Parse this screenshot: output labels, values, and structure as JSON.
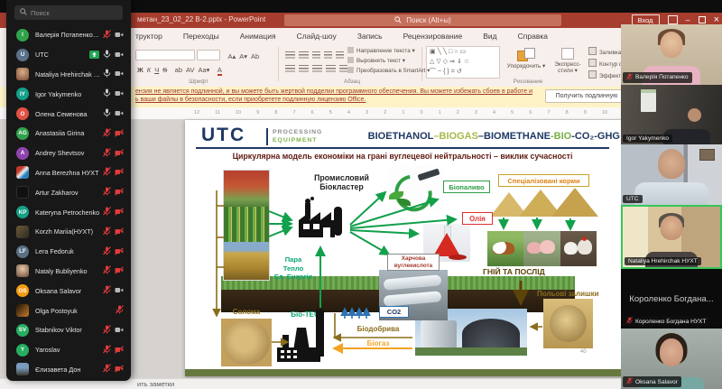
{
  "zoom_panel": {
    "search_placeholder": "Поиск",
    "participants": [
      {
        "name": "Валерія Потапенко (Организатор, я)",
        "type": "initials",
        "initials": "I",
        "color": "#31a24c",
        "mic": "muted",
        "cam": "on"
      },
      {
        "name": "UTC",
        "type": "initials",
        "initials": "U",
        "color": "#5b718a",
        "mic": "on",
        "cam": "on",
        "badge": true
      },
      {
        "name": "Nataliya Hrehirchak НУХТ",
        "type": "photo",
        "photo": "ph-warm",
        "mic": "on",
        "cam": "on"
      },
      {
        "name": "Igor Yakymenko",
        "type": "initials",
        "initials": "IY",
        "color": "#13a089",
        "mic": "on",
        "cam": "on"
      },
      {
        "name": "Олена Семенова",
        "type": "initials",
        "initials": "O",
        "color": "#e25041",
        "mic": "on",
        "cam": "on"
      },
      {
        "name": "Anastasiia Girina",
        "type": "initials",
        "initials": "AG",
        "color": "#31a24c",
        "mic": "muted",
        "cam": "off"
      },
      {
        "name": "Andrey Shevtsov",
        "type": "initials",
        "initials": "A",
        "color": "#8e44ad",
        "mic": "muted",
        "cam": "off"
      },
      {
        "name": "Anna Berezhna НУХТ",
        "type": "photo",
        "photo": "ph-mixed",
        "mic": "muted",
        "cam": "off"
      },
      {
        "name": "Artur Zakharov",
        "type": "photo",
        "photo": "ph-dark",
        "mic": "muted",
        "cam": "off"
      },
      {
        "name": "Kateryna Petrochenko",
        "type": "initials",
        "initials": "KP",
        "color": "#16a085",
        "mic": "muted",
        "cam": "off"
      },
      {
        "name": "Korzh Mariia(НУХТ)",
        "type": "photo",
        "photo": "ph-olive",
        "mic": "muted",
        "cam": "off"
      },
      {
        "name": "Lera Fedoruk",
        "type": "initials",
        "initials": "LF",
        "color": "#5a7184",
        "mic": "muted",
        "cam": "off"
      },
      {
        "name": "Nataly Bubliyenko",
        "type": "photo",
        "photo": "ph-portrait",
        "mic": "muted",
        "cam": "off"
      },
      {
        "name": "Oksana Salavor",
        "type": "initials",
        "initials": "OS",
        "color": "#f39c12",
        "mic": "muted",
        "cam": "on"
      },
      {
        "name": "Olga Postoyuk",
        "type": "photo",
        "photo": "ph-fire",
        "mic": "muted",
        "cam": "none"
      },
      {
        "name": "Stabnikov Viktor",
        "type": "initials",
        "initials": "SV",
        "color": "#27ae60",
        "mic": "muted",
        "cam": "on"
      },
      {
        "name": "Yaroslav",
        "type": "initials",
        "initials": "Y",
        "color": "#27ae60",
        "mic": "muted",
        "cam": "off"
      },
      {
        "name": "Єлизавета Дон",
        "type": "photo",
        "photo": "ph-landscape",
        "mic": "muted",
        "cam": "off"
      }
    ]
  },
  "powerpoint": {
    "titlebar": {
      "document_title": "метан_23_02_22 В-2.pptx  -  PowerPoint",
      "search_placeholder": "Поиск (Alt+ы)",
      "sign_in_label": "Вход"
    },
    "tabs": [
      "труктор",
      "Переходы",
      "Анимация",
      "Слайд-шоу",
      "Запись",
      "Рецензирование",
      "Вид",
      "Справка"
    ],
    "ribbon": {
      "group_font": "Шрифт",
      "group_paragraph": "Абзац",
      "group_drawing": "Рисование",
      "paragraph_buttons": [
        "Направление текста",
        "Выровнять текст",
        "Преобразовать в SmartArt"
      ],
      "arrange_label": "Упорядочить",
      "styles_label_1": "Экспресс-",
      "styles_label_2": "стили",
      "fill_label": "Заливка ф",
      "outline_label": "Контур фи",
      "effects_label": "Эффекты ф"
    },
    "license_bar": {
      "line1": "ензия не является подлинной, и вы можете быть жертвой подделки программного обеспечения. Вы можете избежать сбоев в работе и",
      "line2": "ь ваши файлы в безопасности, если приобретете подлинную лицензию Office.",
      "button_label": "Получить подлинную"
    },
    "ruler_numbers": [
      "12",
      "11",
      "10",
      "9",
      "8",
      "7",
      "6",
      "5",
      "4",
      "3",
      "2",
      "1",
      "0",
      "1",
      "2",
      "3",
      "4",
      "5",
      "6",
      "7",
      "8",
      "9",
      "10"
    ],
    "status_notes": "ить заметки"
  },
  "slide": {
    "logo_text": "UTC",
    "logo_processing": "PROCESSING",
    "logo_equipment": "EQUIPMENT",
    "header_title_parts": [
      {
        "text": "BIOETHANOL",
        "color": "#1f3864"
      },
      {
        "text": "–BIOGAS",
        "color": "#a9b949"
      },
      {
        "text": "–BIOMETHANE",
        "color": "#1f3864"
      },
      {
        "text": "-BIO",
        "color": "#76b043"
      },
      {
        "text": "-CO₂-GHG",
        "color": "#1f3864"
      }
    ],
    "subtitle": "Циркулярна модель економіки на грані вуглецевої нейтральності – виклик сучасності",
    "labels": {
      "cluster": "Промисловий\nБіокластер",
      "steam": "Пара\nТепло\nЕл. Енергія",
      "biofuel": "Біопаливо",
      "feed": "Спеціалізовані корми",
      "oil": "Олія",
      "food_co2": "Харчова\nвуглекислота",
      "co2": "CO2",
      "manure": "ГНІЙ ТА ПОСЛІД",
      "field_residues": "Польові залишки",
      "straw": "Солома",
      "bio_tes": "Біо-ТЕС",
      "biofertilizer": "Біодобрива",
      "biogas": "Біогаз",
      "page_number": "40"
    }
  },
  "video_strip": {
    "tiles": [
      {
        "label": "Валерія Потапенко",
        "muted": true,
        "scene": "valeriia"
      },
      {
        "label": "Igor Yakymenko",
        "muted": false,
        "scene": "igor"
      },
      {
        "label": "UTC",
        "muted": false,
        "scene": "utc-sc"
      },
      {
        "label": "Nataliya Hrehirchak НУХТ",
        "muted": false,
        "scene": "nataliya",
        "active": true
      },
      {
        "label": "Короленко Богдана НУХТ",
        "muted": true,
        "scene": "black-sc",
        "center_text": "Короленко Богдана..."
      },
      {
        "label": "Oksana Salavor",
        "muted": true,
        "scene": "oksana"
      }
    ]
  }
}
